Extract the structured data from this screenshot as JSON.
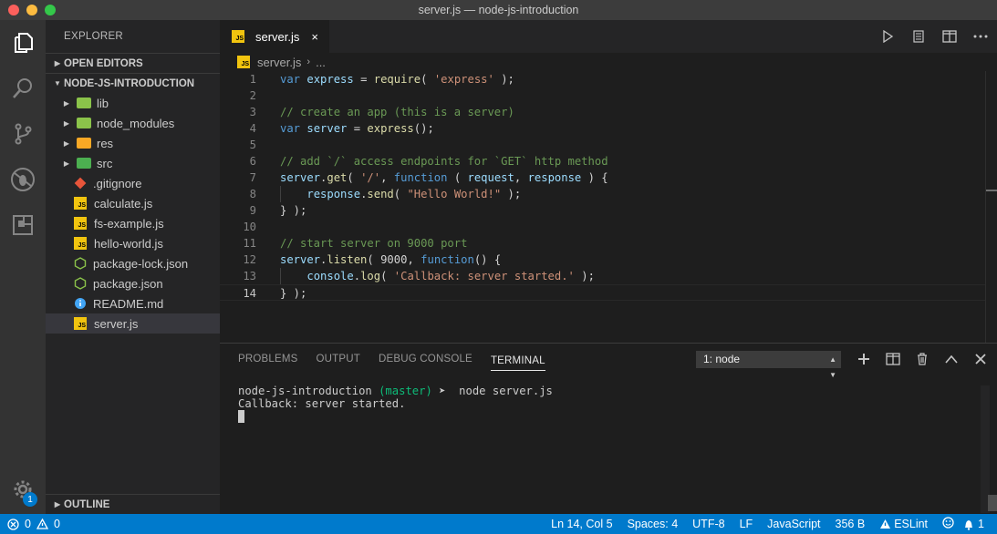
{
  "window": {
    "title": "server.js — node-js-introduction"
  },
  "colors": {
    "accent": "#007acc",
    "js_icon": "#f1c40f",
    "keyword": "#569cd6",
    "string": "#ce9178",
    "comment": "#6a9955"
  },
  "activity_bar": {
    "badge": "1",
    "icons": [
      "files-icon",
      "search-icon",
      "source-control-icon",
      "debug-icon",
      "extensions-icon",
      "settings-gear-icon"
    ]
  },
  "sidebar": {
    "title": "EXPLORER",
    "open_editors": "OPEN EDITORS",
    "project": "NODE-JS-INTRODUCTION",
    "outline": "OUTLINE",
    "items": [
      {
        "label": "lib",
        "kind": "folder",
        "color": "#8bc34a"
      },
      {
        "label": "node_modules",
        "kind": "folder",
        "color": "#8bc34a"
      },
      {
        "label": "res",
        "kind": "folder",
        "color": "#f9a825"
      },
      {
        "label": "src",
        "kind": "folder",
        "color": "#4caf50"
      },
      {
        "label": ".gitignore",
        "kind": "git"
      },
      {
        "label": "calculate.js",
        "kind": "js"
      },
      {
        "label": "fs-example.js",
        "kind": "js"
      },
      {
        "label": "hello-world.js",
        "kind": "js"
      },
      {
        "label": "package-lock.json",
        "kind": "node"
      },
      {
        "label": "package.json",
        "kind": "node"
      },
      {
        "label": "README.md",
        "kind": "info"
      },
      {
        "label": "server.js",
        "kind": "js"
      }
    ]
  },
  "editor": {
    "tab": {
      "name": "server.js",
      "close": "×"
    },
    "tab_icon": "JS",
    "breadcrumb": {
      "file": "server.js",
      "sep": "›",
      "rest": "..."
    },
    "actions": [
      "run-icon",
      "open-preview-icon",
      "split-editor-icon",
      "more-actions-icon"
    ],
    "lines": [
      {
        "n": "1",
        "tokens": [
          [
            "kw",
            "var"
          ],
          [
            "pl",
            " "
          ],
          [
            "var",
            "express"
          ],
          [
            "pl",
            " = "
          ],
          [
            "fn",
            "require"
          ],
          [
            "pl",
            "( "
          ],
          [
            "str",
            "'express'"
          ],
          [
            "pl",
            " );"
          ]
        ]
      },
      {
        "n": "2",
        "tokens": []
      },
      {
        "n": "3",
        "tokens": [
          [
            "cm",
            "// create an app (this is a server)"
          ]
        ]
      },
      {
        "n": "4",
        "tokens": [
          [
            "kw",
            "var"
          ],
          [
            "pl",
            " "
          ],
          [
            "var",
            "server"
          ],
          [
            "pl",
            " = "
          ],
          [
            "fn",
            "express"
          ],
          [
            "pl",
            "();"
          ]
        ]
      },
      {
        "n": "5",
        "tokens": []
      },
      {
        "n": "6",
        "tokens": [
          [
            "cm",
            "// add `/` access endpoints for `GET` http method"
          ]
        ]
      },
      {
        "n": "7",
        "tokens": [
          [
            "var",
            "server"
          ],
          [
            "pl",
            "."
          ],
          [
            "fn",
            "get"
          ],
          [
            "pl",
            "( "
          ],
          [
            "str",
            "'/'"
          ],
          [
            "pl",
            ", "
          ],
          [
            "kw",
            "function"
          ],
          [
            "pl",
            " ( "
          ],
          [
            "var",
            "request"
          ],
          [
            "pl",
            ", "
          ],
          [
            "var",
            "response"
          ],
          [
            "pl",
            " ) {"
          ]
        ]
      },
      {
        "n": "8",
        "tokens": [
          [
            "pl",
            "    "
          ],
          [
            "var",
            "response"
          ],
          [
            "pl",
            "."
          ],
          [
            "fn",
            "send"
          ],
          [
            "pl",
            "( "
          ],
          [
            "str",
            "\"Hello World!\""
          ],
          [
            "pl",
            " );"
          ]
        ]
      },
      {
        "n": "9",
        "tokens": [
          [
            "pl",
            "} );"
          ]
        ]
      },
      {
        "n": "10",
        "tokens": []
      },
      {
        "n": "11",
        "tokens": [
          [
            "cm",
            "// start server on 9000 port"
          ]
        ]
      },
      {
        "n": "12",
        "tokens": [
          [
            "var",
            "server"
          ],
          [
            "pl",
            "."
          ],
          [
            "fn",
            "listen"
          ],
          [
            "pl",
            "( "
          ],
          [
            "pl",
            "9000"
          ],
          [
            "pl",
            ", "
          ],
          [
            "kw",
            "function"
          ],
          [
            "pl",
            "() {"
          ]
        ]
      },
      {
        "n": "13",
        "tokens": [
          [
            "pl",
            "    "
          ],
          [
            "var",
            "console"
          ],
          [
            "pl",
            "."
          ],
          [
            "fn",
            "log"
          ],
          [
            "pl",
            "( "
          ],
          [
            "str",
            "'Callback: server started.'"
          ],
          [
            "pl",
            " );"
          ]
        ]
      },
      {
        "n": "14",
        "tokens": [
          [
            "pl",
            "} );"
          ]
        ]
      }
    ]
  },
  "panel": {
    "tabs": [
      "PROBLEMS",
      "OUTPUT",
      "DEBUG CONSOLE",
      "TERMINAL"
    ],
    "active_tab": "TERMINAL",
    "terminal_select": "1: node",
    "terminal": {
      "prompt_dir": "node-js-introduction",
      "prompt_branch": "(master)",
      "prompt_arrow": "➤",
      "command": "node server.js",
      "output": "Callback: server started."
    }
  },
  "statusbar": {
    "errors": "0",
    "warnings": "0",
    "position": "Ln 14, Col 5",
    "spaces": "Spaces: 4",
    "encoding": "UTF-8",
    "eol": "LF",
    "language": "JavaScript",
    "size": "356 B",
    "eslint": "ESLint",
    "notifications": "1"
  }
}
